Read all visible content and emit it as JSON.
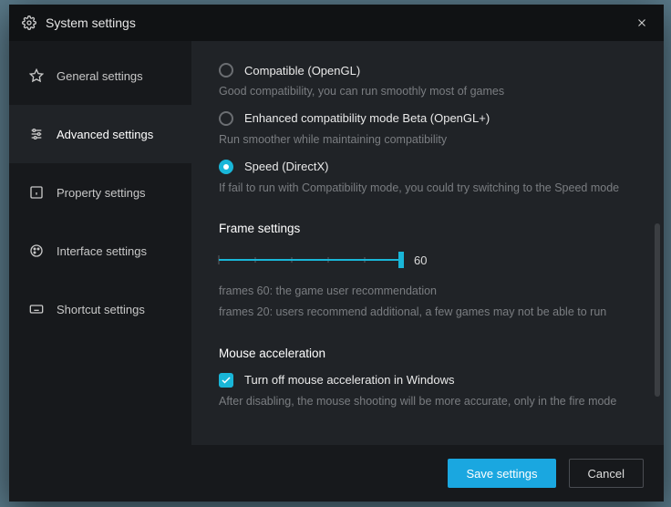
{
  "window": {
    "title": "System settings"
  },
  "sidebar": {
    "items": [
      {
        "label": "General settings"
      },
      {
        "label": "Advanced settings"
      },
      {
        "label": "Property settings"
      },
      {
        "label": "Interface settings"
      },
      {
        "label": "Shortcut settings"
      }
    ],
    "active_index": 1
  },
  "rendering": {
    "options": [
      {
        "label": "Compatible (OpenGL)",
        "desc": "Good compatibility, you can run smoothly most of games",
        "selected": false
      },
      {
        "label": "Enhanced compatibility mode Beta (OpenGL+)",
        "desc": "Run smoother while maintaining compatibility",
        "selected": false
      },
      {
        "label": "Speed (DirectX)",
        "desc": " If fail to run with Compatibility mode, you could try switching to the Speed mode",
        "selected": true
      }
    ]
  },
  "frame": {
    "title": "Frame settings",
    "value": 60,
    "desc1": "frames 60: the game user recommendation",
    "desc2": "frames 20: users recommend additional, a few games may not be able to run"
  },
  "mouse": {
    "title": "Mouse acceleration",
    "checkbox_label": "Turn off mouse acceleration in Windows",
    "checked": true,
    "desc": "After disabling, the mouse shooting will be more accurate, only in the fire mode"
  },
  "footer": {
    "save": "Save settings",
    "cancel": "Cancel"
  }
}
